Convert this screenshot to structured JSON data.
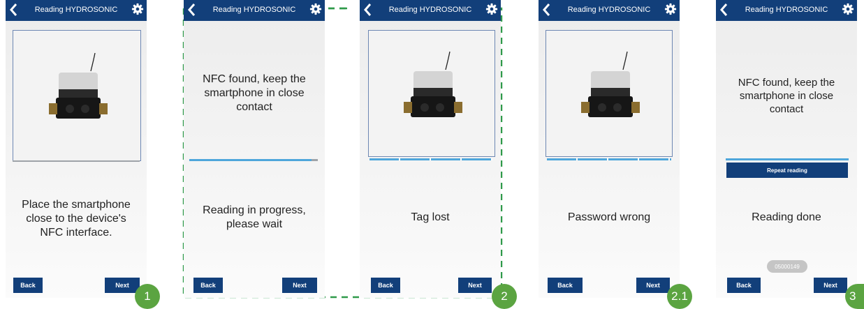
{
  "app_title": "Reading HYDROSONIC",
  "buttons": {
    "back": "Back",
    "next": "Next"
  },
  "screens": [
    {
      "step": "1",
      "message": "Place the smartphone close to the device's NFC interface."
    },
    {
      "step": "2",
      "top_message": "NFC found, keep the smartphone in close contact",
      "message": "Reading in progress, please wait"
    },
    {
      "step": "2",
      "message": "Tag lost"
    },
    {
      "step": "2.1",
      "message": "Password wrong"
    },
    {
      "step": "3",
      "top_message": "NFC found, keep the smartphone in close contact",
      "repeat_button": "Repeat reading",
      "message": "Reading done",
      "serial": "05000149"
    }
  ],
  "colors": {
    "topbar": "#123f7a",
    "badge": "#5ba441",
    "dashed_border": "#2f9a4a",
    "progress": "#4ea6db"
  },
  "icons": [
    "chevron-left-icon",
    "gear-icon"
  ]
}
